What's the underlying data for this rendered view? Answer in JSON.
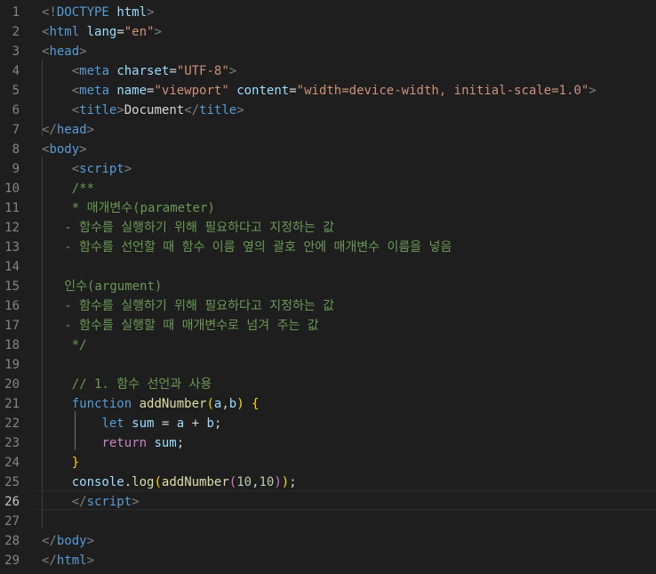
{
  "editor": {
    "active_line": 26,
    "theme_colors": {
      "background": "#1e1e1e",
      "line_number": "#858585",
      "active_line_number": "#c6c6c6",
      "tag": "#569cd6",
      "bracket": "#808080",
      "attribute": "#9cdcfe",
      "string": "#ce9178",
      "comment": "#6a9955",
      "control_keyword": "#c586c0",
      "function_name": "#dcdcaa",
      "number": "#b5cea8"
    },
    "lines": [
      {
        "num": "1",
        "tokens": [
          [
            "br",
            "<!"
          ],
          [
            "tag",
            "DOCTYPE"
          ],
          [
            "txt",
            " "
          ],
          [
            "attr",
            "html"
          ],
          [
            "br",
            ">"
          ]
        ]
      },
      {
        "num": "2",
        "tokens": [
          [
            "br",
            "<"
          ],
          [
            "tag",
            "html"
          ],
          [
            "txt",
            " "
          ],
          [
            "attr",
            "lang"
          ],
          [
            "txt",
            "="
          ],
          [
            "str",
            "\"en\""
          ],
          [
            "br",
            ">"
          ]
        ]
      },
      {
        "num": "3",
        "tokens": [
          [
            "br",
            "<"
          ],
          [
            "tag",
            "head"
          ],
          [
            "br",
            ">"
          ]
        ]
      },
      {
        "num": "4",
        "tokens": [
          [
            "txt",
            "    "
          ],
          [
            "br",
            "<"
          ],
          [
            "tag",
            "meta"
          ],
          [
            "txt",
            " "
          ],
          [
            "attr",
            "charset"
          ],
          [
            "txt",
            "="
          ],
          [
            "str",
            "\"UTF-8\""
          ],
          [
            "br",
            ">"
          ]
        ]
      },
      {
        "num": "5",
        "tokens": [
          [
            "txt",
            "    "
          ],
          [
            "br",
            "<"
          ],
          [
            "tag",
            "meta"
          ],
          [
            "txt",
            " "
          ],
          [
            "attr",
            "name"
          ],
          [
            "txt",
            "="
          ],
          [
            "str",
            "\"viewport\""
          ],
          [
            "txt",
            " "
          ],
          [
            "attr",
            "content"
          ],
          [
            "txt",
            "="
          ],
          [
            "str",
            "\"width=device-width, initial-scale=1.0\""
          ],
          [
            "br",
            ">"
          ]
        ]
      },
      {
        "num": "6",
        "tokens": [
          [
            "txt",
            "    "
          ],
          [
            "br",
            "<"
          ],
          [
            "tag",
            "title"
          ],
          [
            "br",
            ">"
          ],
          [
            "txt",
            "Document"
          ],
          [
            "br",
            "</"
          ],
          [
            "tag",
            "title"
          ],
          [
            "br",
            ">"
          ]
        ]
      },
      {
        "num": "7",
        "tokens": [
          [
            "br",
            "</"
          ],
          [
            "tag",
            "head"
          ],
          [
            "br",
            ">"
          ]
        ]
      },
      {
        "num": "8",
        "tokens": [
          [
            "br",
            "<"
          ],
          [
            "tag",
            "body"
          ],
          [
            "br",
            ">"
          ]
        ]
      },
      {
        "num": "9",
        "tokens": [
          [
            "txt",
            "    "
          ],
          [
            "br",
            "<"
          ],
          [
            "tag",
            "script"
          ],
          [
            "br",
            ">"
          ]
        ]
      },
      {
        "num": "10",
        "tokens": [
          [
            "txt",
            "    "
          ],
          [
            "cm",
            "/**"
          ]
        ]
      },
      {
        "num": "11",
        "tokens": [
          [
            "txt",
            "    "
          ],
          [
            "cm",
            "* 매개변수(parameter)"
          ]
        ]
      },
      {
        "num": "12",
        "tokens": [
          [
            "txt",
            "   "
          ],
          [
            "cm",
            "- 함수를 실행하기 위해 필요하다고 지정하는 값"
          ]
        ]
      },
      {
        "num": "13",
        "tokens": [
          [
            "txt",
            "   "
          ],
          [
            "cm",
            "- 함수를 선언할 때 함수 이름 옆의 괄호 안에 매개변수 이름을 넣음"
          ]
        ]
      },
      {
        "num": "14",
        "tokens": []
      },
      {
        "num": "15",
        "tokens": [
          [
            "txt",
            "   "
          ],
          [
            "cm",
            "인수(argument)"
          ]
        ]
      },
      {
        "num": "16",
        "tokens": [
          [
            "txt",
            "   "
          ],
          [
            "cm",
            "- 함수를 실행하기 위해 필요하다고 지정하는 값"
          ]
        ]
      },
      {
        "num": "17",
        "tokens": [
          [
            "txt",
            "   "
          ],
          [
            "cm",
            "- 함수를 실행할 때 매개변수로 넘겨 주는 값"
          ]
        ]
      },
      {
        "num": "18",
        "tokens": [
          [
            "txt",
            "    "
          ],
          [
            "cm",
            "*/"
          ]
        ]
      },
      {
        "num": "19",
        "tokens": []
      },
      {
        "num": "20",
        "tokens": [
          [
            "txt",
            "    "
          ],
          [
            "cm",
            "// 1. 함수 선언과 사용"
          ]
        ]
      },
      {
        "num": "21",
        "tokens": [
          [
            "txt",
            "    "
          ],
          [
            "kw",
            "function"
          ],
          [
            "txt",
            " "
          ],
          [
            "fn",
            "addNumber"
          ],
          [
            "b1",
            "("
          ],
          [
            "var",
            "a"
          ],
          [
            "txt",
            ","
          ],
          [
            "var",
            "b"
          ],
          [
            "b1",
            ")"
          ],
          [
            "txt",
            " "
          ],
          [
            "b1",
            "{"
          ]
        ]
      },
      {
        "num": "22",
        "tokens": [
          [
            "txt",
            "        "
          ],
          [
            "kw",
            "let"
          ],
          [
            "txt",
            " "
          ],
          [
            "var",
            "sum"
          ],
          [
            "txt",
            " = "
          ],
          [
            "var",
            "a"
          ],
          [
            "txt",
            " + "
          ],
          [
            "var",
            "b"
          ],
          [
            "txt",
            ";"
          ]
        ]
      },
      {
        "num": "23",
        "tokens": [
          [
            "txt",
            "        "
          ],
          [
            "ctl",
            "return"
          ],
          [
            "txt",
            " "
          ],
          [
            "var",
            "sum"
          ],
          [
            "txt",
            ";"
          ]
        ]
      },
      {
        "num": "24",
        "tokens": [
          [
            "txt",
            "    "
          ],
          [
            "b1",
            "}"
          ]
        ]
      },
      {
        "num": "25",
        "tokens": [
          [
            "txt",
            "    "
          ],
          [
            "var",
            "console"
          ],
          [
            "txt",
            "."
          ],
          [
            "fn",
            "log"
          ],
          [
            "b1",
            "("
          ],
          [
            "fn",
            "addNumber"
          ],
          [
            "b2",
            "("
          ],
          [
            "num",
            "10"
          ],
          [
            "txt",
            ","
          ],
          [
            "num",
            "10"
          ],
          [
            "b2",
            ")"
          ],
          [
            "b1",
            ")"
          ],
          [
            "txt",
            ";"
          ]
        ]
      },
      {
        "num": "26",
        "tokens": [
          [
            "txt",
            "    "
          ],
          [
            "br",
            "</"
          ],
          [
            "tag",
            "script"
          ],
          [
            "br",
            ">"
          ]
        ]
      },
      {
        "num": "27",
        "tokens": []
      },
      {
        "num": "28",
        "tokens": [
          [
            "br",
            "</"
          ],
          [
            "tag",
            "body"
          ],
          [
            "br",
            ">"
          ]
        ]
      },
      {
        "num": "29",
        "tokens": [
          [
            "br",
            "</"
          ],
          [
            "tag",
            "html"
          ],
          [
            "br",
            ">"
          ]
        ]
      }
    ]
  }
}
